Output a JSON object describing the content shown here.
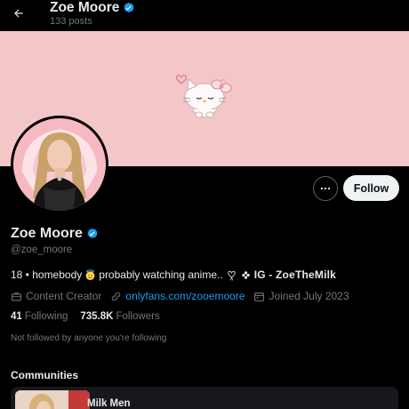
{
  "header": {
    "title": "Zoe Moore",
    "posts": "133 posts"
  },
  "profile": {
    "name": "Zoe Moore",
    "handle": "@zoe_moore",
    "bio_text": "18 • homebody",
    "bio_text2": "probably watching anime..",
    "bio_ig": "IG - ZoeTheMilk",
    "category": "Content Creator",
    "link": "onlyfans.com/zooemoore",
    "joined": "Joined July 2023",
    "following_count": "41",
    "following_label": "Following",
    "followers_count": "735.8K",
    "followers_label": "Followers",
    "not_followed": "Not followed by anyone you're following"
  },
  "actions": {
    "more_label": "•••",
    "follow_label": "Follow"
  },
  "communities": {
    "title": "Communities",
    "items": [
      {
        "name": "Milk Men"
      }
    ]
  },
  "colors": {
    "background": "#000000",
    "banner": "#f3c6c8",
    "accent": "#1d9bf0",
    "muted": "#71767b"
  },
  "icons": {
    "back": "arrow-left-icon",
    "verified": "verified-badge-icon",
    "category": "briefcase-icon",
    "link": "link-icon",
    "calendar": "calendar-icon",
    "more": "more-horizontal-icon"
  }
}
